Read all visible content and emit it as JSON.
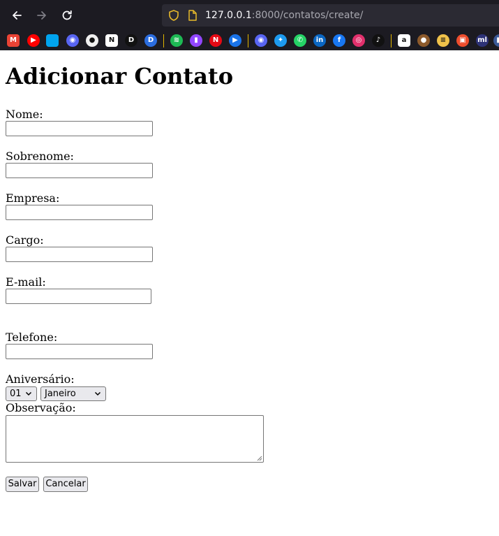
{
  "browser": {
    "url_host": "127.0.0.1",
    "url_rest": ":8000/contatos/create/",
    "bookmarks": [
      {
        "name": "gmail",
        "glyph": "M",
        "color": "#ea4335"
      },
      {
        "name": "youtube",
        "glyph": "▶",
        "color": "#ff0000"
      },
      {
        "name": "microsoft",
        "glyph": "",
        "color": "#00a4ef"
      },
      {
        "name": "discord-alt",
        "glyph": "◉",
        "color": "#5865f2"
      },
      {
        "name": "github",
        "glyph": "●",
        "color": "#f0f0f0"
      },
      {
        "name": "notion",
        "glyph": "N",
        "color": "#ffffff"
      },
      {
        "name": "dev-d",
        "glyph": "D",
        "color": "#111111"
      },
      {
        "name": "dev-d-blue",
        "glyph": "D",
        "color": "#2b6de0"
      },
      {
        "name": "spotify",
        "glyph": "≋",
        "color": "#1db954"
      },
      {
        "name": "twitch",
        "glyph": "▮",
        "color": "#9146ff"
      },
      {
        "name": "netflix",
        "glyph": "N",
        "color": "#e50914"
      },
      {
        "name": "play",
        "glyph": "▶",
        "color": "#1a73e8"
      },
      {
        "name": "discord",
        "glyph": "◉",
        "color": "#5865f2"
      },
      {
        "name": "twitter",
        "glyph": "✦",
        "color": "#1d9bf0"
      },
      {
        "name": "whatsapp",
        "glyph": "✆",
        "color": "#25d366"
      },
      {
        "name": "linkedin",
        "glyph": "in",
        "color": "#0a66c2"
      },
      {
        "name": "facebook",
        "glyph": "f",
        "color": "#1877f2"
      },
      {
        "name": "instagram",
        "glyph": "◎",
        "color": "#e1306c"
      },
      {
        "name": "tiktok",
        "glyph": "♪",
        "color": "#111111"
      },
      {
        "name": "amazon",
        "glyph": "a",
        "color": "#ffffff"
      },
      {
        "name": "monkey",
        "glyph": "●",
        "color": "#8d5a2b"
      },
      {
        "name": "sandwich",
        "glyph": "≡",
        "color": "#f0c24a"
      },
      {
        "name": "shop",
        "glyph": "▣",
        "color": "#ee4d2d"
      },
      {
        "name": "mercadolivre",
        "glyph": "ml",
        "color": "#2d3277"
      },
      {
        "name": "extra",
        "glyph": "■",
        "color": "#3b5998"
      }
    ]
  },
  "page": {
    "title": "Adicionar Contato",
    "fields": {
      "nome": {
        "label": "Nome:",
        "value": ""
      },
      "sobrenome": {
        "label": "Sobrenome:",
        "value": ""
      },
      "empresa": {
        "label": "Empresa:",
        "value": ""
      },
      "cargo": {
        "label": "Cargo:",
        "value": ""
      },
      "email": {
        "label": "E-mail:",
        "value": ""
      },
      "telefone": {
        "label": "Telefone:",
        "value": ""
      },
      "aniversario": {
        "label": "Aniversário:",
        "day": "01",
        "month": "Janeiro"
      },
      "observacao": {
        "label": "Observação:",
        "value": ""
      }
    },
    "buttons": {
      "save": "Salvar",
      "cancel": "Cancelar"
    }
  }
}
